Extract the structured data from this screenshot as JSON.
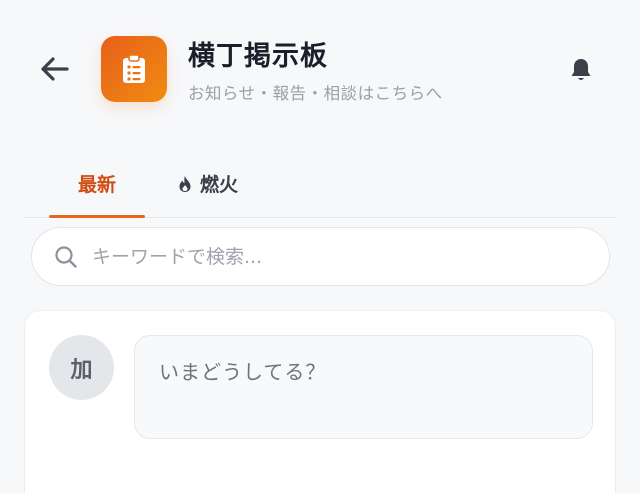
{
  "header": {
    "title": "横丁掲示板",
    "subtitle": "お知らせ・報告・相談はこちらへ",
    "back_icon": "arrow-left-icon",
    "app_icon": "clipboard-list-icon",
    "bell_icon": "bell-icon",
    "accent_gradient": [
      "#e8601b",
      "#f08c10"
    ]
  },
  "tabs": [
    {
      "label": "最新",
      "active": true
    },
    {
      "label": "燃火",
      "icon": "fire-icon",
      "active": false
    }
  ],
  "search": {
    "placeholder": "キーワードで検索...",
    "value": ""
  },
  "composer": {
    "avatar_initial": "加",
    "placeholder": "いまどうしてる？"
  },
  "colors": {
    "accent": "#d14d16",
    "background": "#f7f8fa"
  }
}
